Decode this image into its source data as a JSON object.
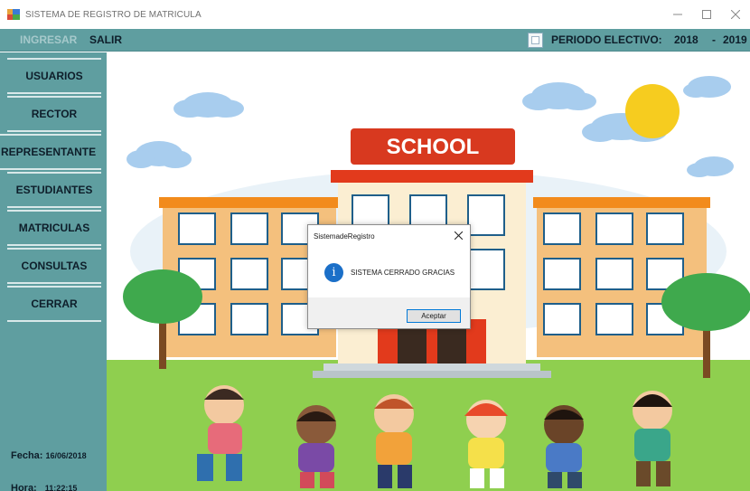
{
  "window": {
    "title": "SISTEMA DE REGISTRO DE MATRICULA"
  },
  "menu": {
    "ingresar": "INGRESAR",
    "salir": "SALIR"
  },
  "period": {
    "label": "PERIODO ELECTIVO:",
    "start_year": "2018",
    "separator": "-",
    "end_year": "2019"
  },
  "sidebar": {
    "items": [
      {
        "label": "USUARIOS"
      },
      {
        "label": "RECTOR"
      },
      {
        "label": "REPRESENTANTE"
      },
      {
        "label": "ESTUDIANTES"
      },
      {
        "label": "MATRICULAS"
      },
      {
        "label": "CONSULTAS"
      },
      {
        "label": "CERRAR"
      }
    ],
    "fecha_label": "Fecha:",
    "fecha_value": "16/06/2018",
    "hora_label": "Hora:",
    "hora_value": "11:22:15"
  },
  "scene": {
    "sign": "SCHOOL"
  },
  "dialog": {
    "title": "SistemadeRegistro",
    "message": "SISTEMA CERRADO GRACIAS",
    "button": "Aceptar",
    "icon": "info-icon"
  },
  "colors": {
    "sidebar": "#5f9ea0",
    "dialog_icon": "#1b6fc8",
    "school_sign": "#d8391f"
  }
}
